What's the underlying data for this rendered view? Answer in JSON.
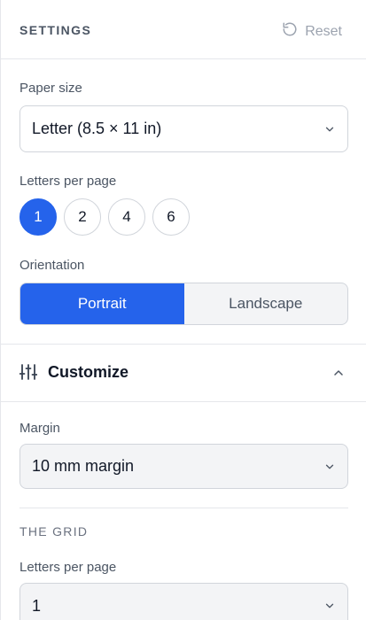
{
  "header": {
    "title": "SETTINGS",
    "reset_label": "Reset"
  },
  "paper_size": {
    "label": "Paper size",
    "value": "Letter (8.5 × 11 in)"
  },
  "letters_per_page": {
    "label": "Letters per page",
    "options": [
      "1",
      "2",
      "4",
      "6"
    ],
    "selected": "1"
  },
  "orientation": {
    "label": "Orientation",
    "options": [
      "Portrait",
      "Landscape"
    ],
    "selected": "Portrait"
  },
  "customize": {
    "title": "Customize",
    "expanded": true
  },
  "margin": {
    "label": "Margin",
    "value": "10 mm margin"
  },
  "grid": {
    "section_title": "THE GRID",
    "letters_per_page_label": "Letters per page",
    "letters_per_page_value": "1"
  },
  "colors": {
    "accent": "#2563eb",
    "border": "#d1d5db",
    "muted": "#9ca3af"
  }
}
